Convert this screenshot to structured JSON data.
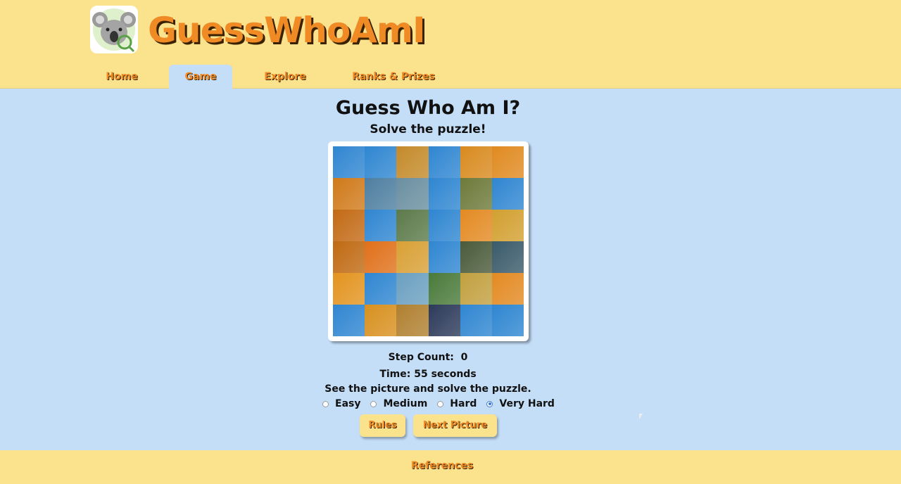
{
  "header": {
    "brand": "GuessWhoAmI",
    "nav": [
      {
        "label": "Home",
        "active": false
      },
      {
        "label": "Game",
        "active": true
      },
      {
        "label": "Explore",
        "active": false
      },
      {
        "label": "Ranks & Prizes",
        "active": false
      }
    ]
  },
  "game": {
    "title": "Guess Who Am I?",
    "subtitle": "Solve the puzzle!",
    "step_count_label": "Step Count:",
    "step_count": "0",
    "time_text": "Time: 55 seconds",
    "instruction": "See the picture and solve the puzzle.",
    "difficulties": [
      {
        "label": "Easy",
        "selected": false
      },
      {
        "label": "Medium",
        "selected": false
      },
      {
        "label": "Hard",
        "selected": false
      },
      {
        "label": "Very Hard",
        "selected": true
      }
    ],
    "buttons": {
      "rules": "Rules",
      "next": "Next Picture"
    },
    "tile_colors": [
      "#2f86d1",
      "#2f86d1",
      "#c48a2a",
      "#2f86d1",
      "#d98a1f",
      "#e08a20",
      "#d07a1a",
      "#4e7fa0",
      "#6a8fa0",
      "#2f86d1",
      "#6d7a3a",
      "#2f86d1",
      "#c36a15",
      "#2f86d1",
      "#5c7a4a",
      "#2f86d1",
      "#e38a22",
      "#d2a030",
      "#c06a12",
      "#e0701a",
      "#d9a035",
      "#2f86d1",
      "#4a5a3a",
      "#3a5a6a",
      "#e3941f",
      "#2f86d1",
      "#6aa0c0",
      "#4a7a3a",
      "#c2a040",
      "#e38a22",
      "#2f86d1",
      "#d8901f",
      "#b08030",
      "#2c3a5a",
      "#2f86d1",
      "#2f86d1"
    ]
  },
  "footer": {
    "references": "References"
  },
  "colors": {
    "header_bg": "#fbe38e",
    "page_bg": "#c5def8",
    "accent": "#f08a25"
  }
}
